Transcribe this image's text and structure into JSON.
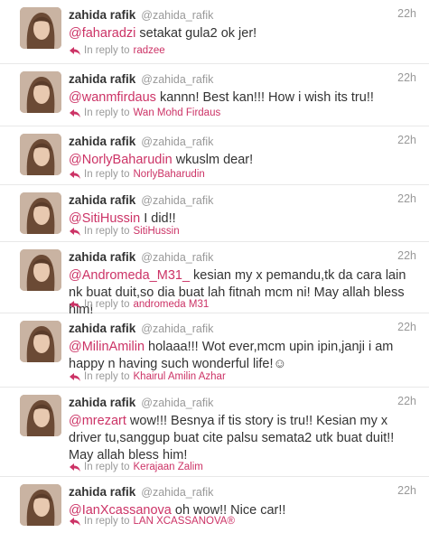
{
  "tweets": [
    {
      "name": "zahida rafik",
      "handle": "@zahida_rafik",
      "time": "22h",
      "mention": "@faharadzi",
      "text": " setakat gula2 ok jer!",
      "reply_label": "In reply to",
      "reply_to": "radzee"
    },
    {
      "name": "zahida rafik",
      "handle": "@zahida_rafik",
      "time": "22h",
      "mention": "@wanmfirdaus",
      "text": " kannn! Best kan!!! How i wish its tru!!",
      "reply_label": "In reply to",
      "reply_to": "Wan Mohd Firdaus"
    },
    {
      "name": "zahida rafik",
      "handle": "@zahida_rafik",
      "time": "22h",
      "mention": "@NorlyBaharudin",
      "text": " wkuslm dear!",
      "reply_label": "In reply to",
      "reply_to": "NorlyBaharudin"
    },
    {
      "name": "zahida rafik",
      "handle": "@zahida_rafik",
      "time": "22h",
      "mention": "@SitiHussin",
      "text": " I did!!",
      "reply_label": "In reply to",
      "reply_to": "SitiHussin"
    },
    {
      "name": "zahida rafik",
      "handle": "@zahida_rafik",
      "time": "22h",
      "mention": "@Andromeda_M31_",
      "text": " kesian my x pemandu,tk da cara lain nk buat duit,so dia buat lah fitnah mcm ni! May allah bless him!",
      "reply_label": "In reply to",
      "reply_to": "andromeda M31"
    },
    {
      "name": "zahida rafik",
      "handle": "@zahida_rafik",
      "time": "22h",
      "mention": "@MilinAmilin",
      "text": " holaaa!!! Wot ever,mcm upin ipin,janji i am happy n having such wonderful life!☺",
      "reply_label": "In reply to",
      "reply_to": "Khairul Amilin Azhar"
    },
    {
      "name": "zahida rafik",
      "handle": "@zahida_rafik",
      "time": "22h",
      "mention": "@mrezart",
      "text": " wow!!! Besnya if tis story is tru!! Kesian my x driver tu,sanggup buat cite palsu semata2 utk buat duit!! May allah bless him!",
      "reply_label": "In reply to",
      "reply_to": "Kerajaan Zalim"
    },
    {
      "name": "zahida rafik",
      "handle": "@zahida_rafik",
      "time": "22h",
      "mention": "@IanXcassanova",
      "text": " oh wow!! Nice car!!",
      "reply_label": "In reply to",
      "reply_to": "LAN XCASSANOVA®"
    }
  ],
  "colors": {
    "mention": "#cc3366",
    "muted": "#999999",
    "text": "#333333"
  },
  "icons": {
    "reply": "reply-arrow-icon"
  }
}
